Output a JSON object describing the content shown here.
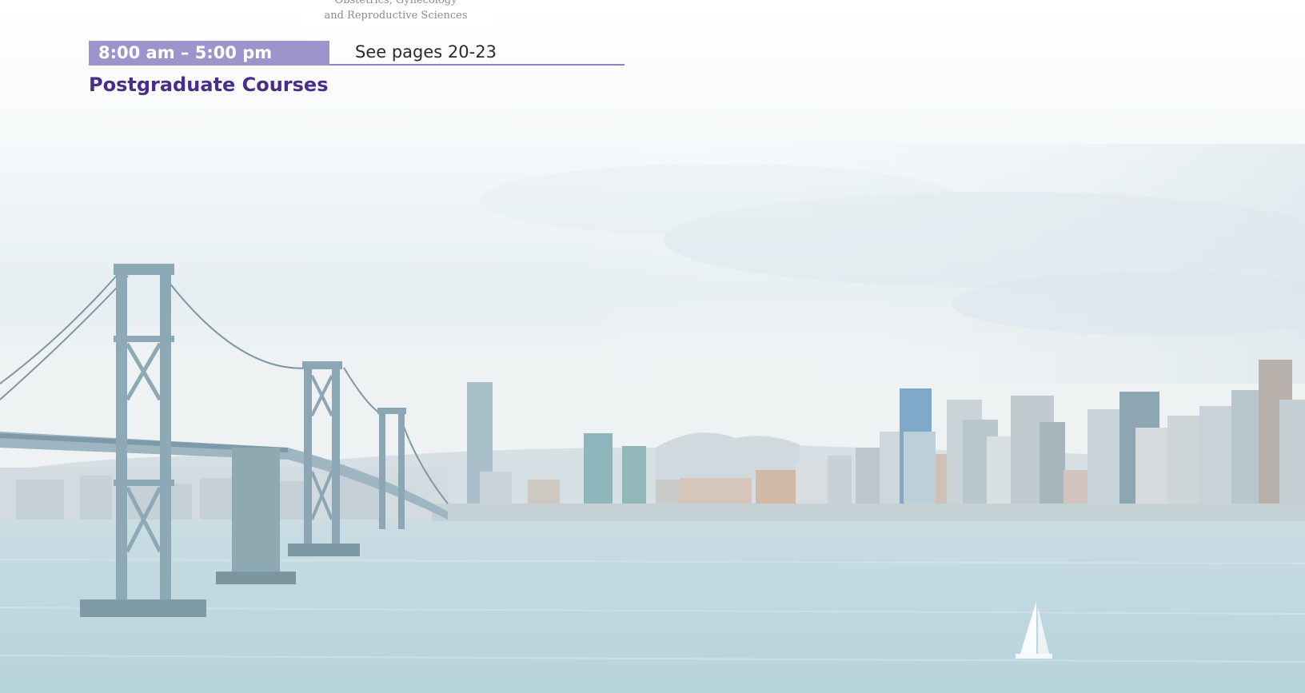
{
  "logo": {
    "line1": "Obstetrics, Gynecology",
    "line2": "and Reproductive Sciences"
  },
  "schedule": {
    "time": "8:00 am – 5:00 pm",
    "pages": "See pages 20-23"
  },
  "section_title": "Postgraduate Courses",
  "colors": {
    "time_bg": "#9b95cb",
    "title": "#4a2d8a",
    "rule": "#8a86c6"
  }
}
